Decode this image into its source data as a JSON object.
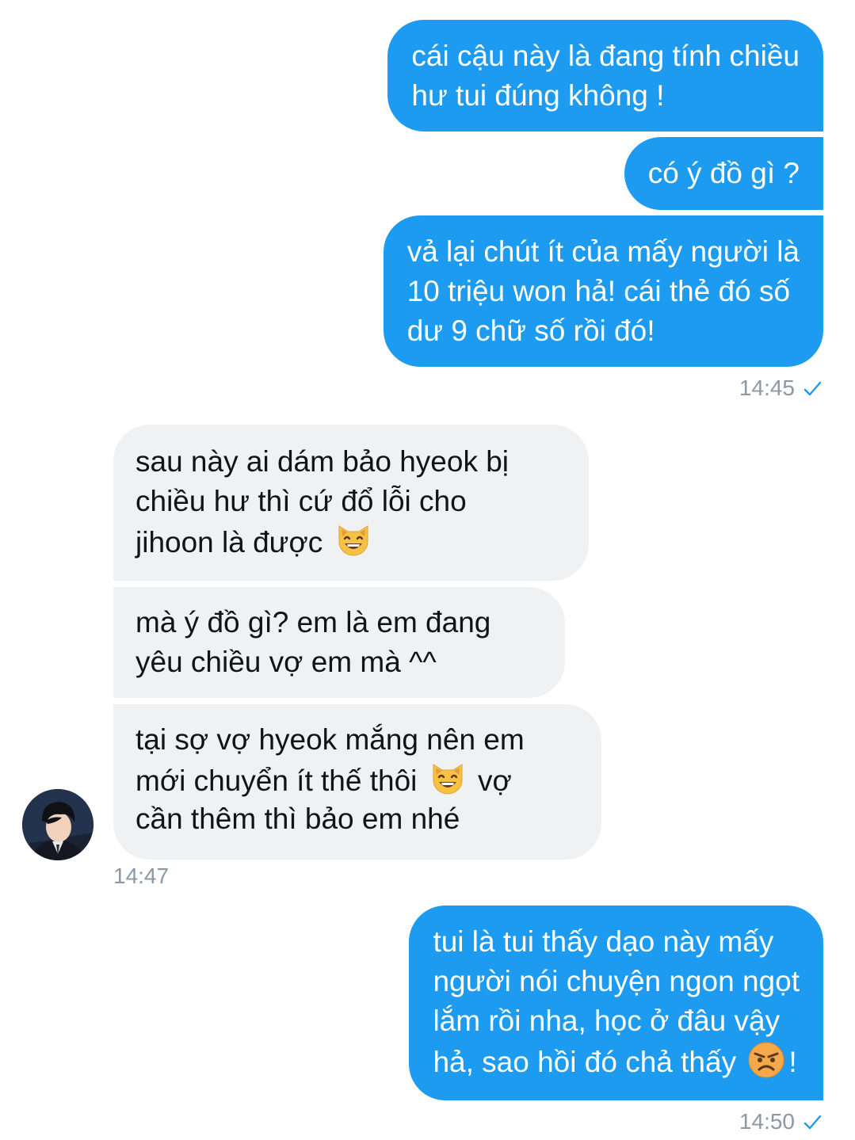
{
  "messages": [
    {
      "lines": [
        "cái cậu này là đang tính chiều",
        "hư tui đúng không !"
      ]
    },
    {
      "lines": [
        "có ý đồ gì ?"
      ]
    },
    {
      "lines": [
        "vả lại chút ít của mấy người là",
        "10 triệu won hả! cái thẻ đó số",
        "dư 9 chữ số rồi đó!"
      ]
    },
    {
      "lines": [
        "sau này ai dám bảo hyeok bị",
        "chiều hư thì cứ đổ lỗi cho",
        "jihoon là được"
      ]
    },
    {
      "lines": [
        "mà ý đồ gì? em là em đang",
        "yêu chiều vợ em mà ^^"
      ]
    },
    {
      "lines": [
        "tại sợ vợ hyeok mắng nên em",
        "mới chuyển ít thế thôi",
        "vợ",
        "cần thêm thì bảo em nhé"
      ]
    },
    {
      "lines": [
        "tui là tui thấy dạo này mấy",
        "người nói chuyện ngon ngọt",
        "lắm rồi nha, học ở đâu vậy",
        "hả, sao hồi đó chả thấy",
        "!"
      ]
    }
  ],
  "timestamps": {
    "first": "14:45",
    "second": "14:47",
    "third": "14:50"
  },
  "icons": {
    "smiling_cat": "smiling-cat-emoji",
    "angry_face": "angry-face-emoji",
    "read_check": "check-icon"
  },
  "colors": {
    "outgoing_bubble": "#1d9bf0",
    "incoming_bubble": "#eff1f3",
    "timestamp": "#8b98a5",
    "check": "#1d9bf0"
  }
}
